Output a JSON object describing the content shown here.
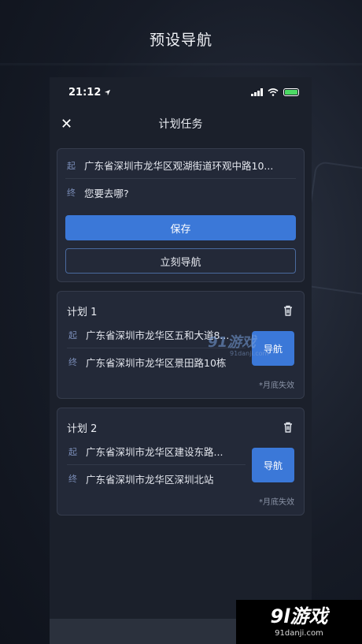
{
  "promo": {
    "title": "预设导航"
  },
  "status": {
    "time": "21:12"
  },
  "nav": {
    "title": "计划任务",
    "close": "✕"
  },
  "entry": {
    "start_tag": "起",
    "start": "广东省深圳市龙华区观湖街道环观中路10...",
    "end_tag": "终",
    "end_placeholder": "您要去哪?",
    "save_label": "保存",
    "navigate_label": "立刻导航"
  },
  "plans": [
    {
      "name": "计划 1",
      "start_tag": "起",
      "start": "广东省深圳市龙华区五和大道8...",
      "end_tag": "终",
      "end": "广东省深圳市龙华区景田路10栋",
      "nav_label": "导航",
      "expire": "*月底失效"
    },
    {
      "name": "计划 2",
      "start_tag": "起",
      "start": "广东省深圳市龙华区建设东路...",
      "end_tag": "终",
      "end": "广东省深圳市龙华区深圳北站",
      "nav_label": "导航",
      "expire": "*月底失效"
    }
  ],
  "watermark": {
    "center": "91游戏",
    "center_sub": "91danji.com",
    "logo": "9l游戏",
    "logo_sub": "91danji.com"
  },
  "colors": {
    "accent": "#3b78d8",
    "battery": "#4cd964",
    "background": "#1b202b"
  }
}
